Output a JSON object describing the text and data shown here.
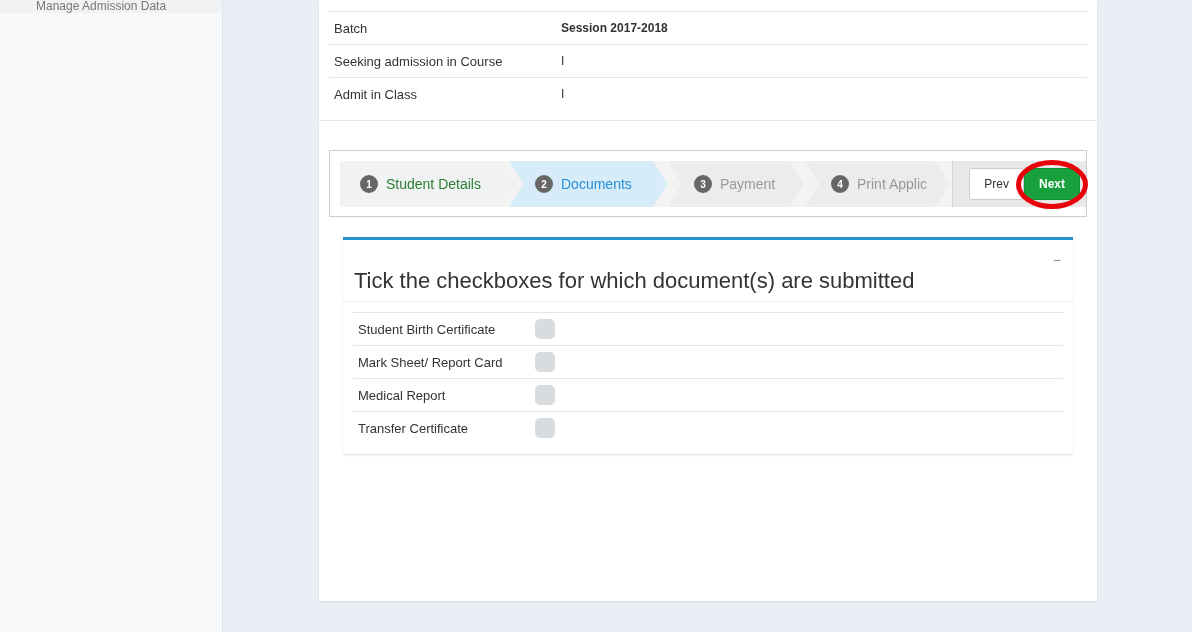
{
  "sidebar": {
    "items": [
      {
        "label": "Manage Admission Data"
      }
    ]
  },
  "details": [
    {
      "label": "Batch",
      "value": "Session 2017-2018",
      "bold": true
    },
    {
      "label": "Seeking admission in Course",
      "value": "I",
      "bold": false
    },
    {
      "label": "Admit in Class",
      "value": "I",
      "bold": false
    }
  ],
  "wizard": {
    "steps": [
      {
        "number": "1",
        "label": "Student Details",
        "kind": "done"
      },
      {
        "number": "2",
        "label": "Documents",
        "kind": "active"
      },
      {
        "number": "3",
        "label": "Payment",
        "kind": "pending"
      },
      {
        "number": "4",
        "label": "Print Applic",
        "kind": "pending"
      }
    ],
    "buttons": [
      {
        "label": "Prev",
        "kind": "default",
        "highlighted": false
      },
      {
        "label": "Next",
        "kind": "primary",
        "highlighted": true
      }
    ]
  },
  "documents": {
    "title": "Tick the checkboxes for which document(s) are submitted",
    "collapse": "−",
    "items": [
      {
        "label": "Student Birth Certificate",
        "checked": false
      },
      {
        "label": "Mark Sheet/ Report Card",
        "checked": false
      },
      {
        "label": "Medical Report",
        "checked": false
      },
      {
        "label": "Transfer Certificate",
        "checked": false
      }
    ]
  }
}
